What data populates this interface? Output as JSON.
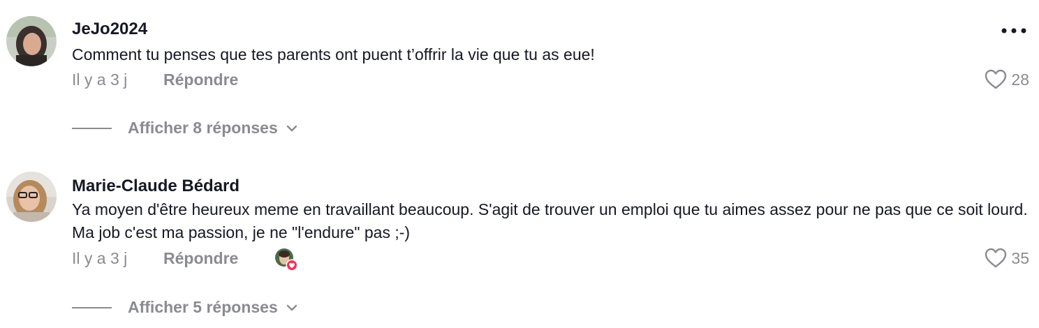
{
  "comments": [
    {
      "username": "JeJo2024",
      "text": "Comment tu penses que tes parents ont puent t’offrir la vie que tu as eue!",
      "time": "Il y a 3 j",
      "reply_label": "Répondre",
      "likes": "28",
      "view_replies": "Afficher 8 réponses"
    },
    {
      "username": "Marie-Claude Bédard",
      "text": "Ya moyen d'être heureux meme en travaillant beaucoup. S'agit de trouver un emploi que tu aimes assez pour ne pas que ce soit lourd. Ma job c'est ma passion, je ne \"l'endure\" pas ;-)",
      "time": "Il y a 3 j",
      "reply_label": "Répondre",
      "likes": "35",
      "view_replies": "Afficher 5 réponses"
    }
  ],
  "icons": {
    "more": "more-horizontal-icon",
    "like": "heart-outline-icon",
    "expand": "chevron-down-icon",
    "creator_liked": "heart-badge-icon"
  },
  "colors": {
    "text_primary": "#161823",
    "text_secondary": "#8a8b91",
    "like_badge": "#fe2c55"
  }
}
